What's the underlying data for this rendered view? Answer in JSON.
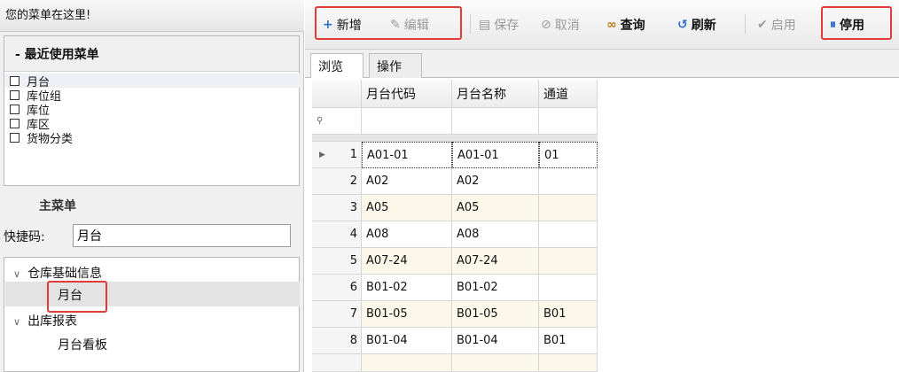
{
  "menu_header": "您的菜单在这里!",
  "recent": {
    "title": "- 最近使用菜单",
    "items": [
      "月台",
      "库位组",
      "库位",
      "库区",
      "货物分类"
    ]
  },
  "main_menu": {
    "title": "主菜单",
    "shortcut_label": "快捷码:",
    "shortcut_value": "月台"
  },
  "tree": {
    "groups": [
      {
        "label": "仓库基础信息",
        "children": [
          "月台"
        ]
      },
      {
        "label": "出库报表",
        "children": [
          "月台看板"
        ]
      }
    ]
  },
  "toolbar": {
    "add": "新增",
    "edit": "编辑",
    "save": "保存",
    "cancel": "取消",
    "query": "查询",
    "refresh": "刷新",
    "enable": "启用",
    "disable": "停用"
  },
  "tabs": [
    "浏览",
    "操作"
  ],
  "grid": {
    "columns": [
      "月台代码",
      "月台名称",
      "通道"
    ],
    "filter_icon": "filter-pin-icon",
    "rows": [
      {
        "no": "1",
        "code": "A01-01",
        "name": "A01-01",
        "channel": "01"
      },
      {
        "no": "2",
        "code": "A02",
        "name": "A02",
        "channel": ""
      },
      {
        "no": "3",
        "code": "A05",
        "name": "A05",
        "channel": ""
      },
      {
        "no": "4",
        "code": "A08",
        "name": "A08",
        "channel": ""
      },
      {
        "no": "5",
        "code": "A07-24",
        "name": "A07-24",
        "channel": ""
      },
      {
        "no": "6",
        "code": "B01-02",
        "name": "B01-02",
        "channel": ""
      },
      {
        "no": "7",
        "code": "B01-05",
        "name": "B01-05",
        "channel": "B01"
      },
      {
        "no": "8",
        "code": "B01-04",
        "name": "B01-04",
        "channel": "B01"
      }
    ]
  },
  "colors": {
    "highlight": "#e23b3b",
    "add_icon": "#2e6fc9",
    "disable_icon": "#2e6fc9"
  }
}
